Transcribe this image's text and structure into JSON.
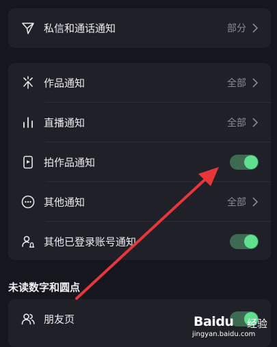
{
  "sections": {
    "top_group": [
      {
        "label": "私信和通话通知",
        "value": "部分",
        "icon": "paper-plane-icon"
      }
    ],
    "main_group": [
      {
        "label": "作品通知",
        "value": "全部",
        "icon": "sparkle-icon"
      },
      {
        "label": "直播通知",
        "value": "全部",
        "icon": "bar-chart-icon"
      },
      {
        "label": "拍作品通知",
        "toggle": true,
        "icon": "phone-camera-icon"
      },
      {
        "label": "其他通知",
        "value": "全部",
        "icon": "more-circle-icon"
      },
      {
        "label": "其他已登录账号通知",
        "toggle": true,
        "icon": "user-bell-icon"
      }
    ],
    "unread_title": "未读数字和圆点",
    "unread_group": [
      {
        "label": "朋友页",
        "toggle": true,
        "icon": "friends-icon"
      }
    ]
  },
  "colors": {
    "background": "#16161e",
    "card": "#202029",
    "toggle_on": "#5ee08f",
    "annotation_arrow": "#e8373a"
  },
  "watermark": {
    "main": "Baidu",
    "cn": "经验",
    "url": "jingyan.baidu.com"
  }
}
